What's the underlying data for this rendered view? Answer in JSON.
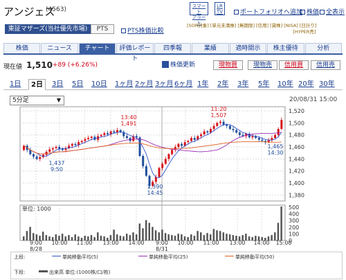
{
  "header": {
    "company": "アンジェス",
    "code": "(4563)",
    "smart_alert": "スマート\nアラート",
    "lr_tv": "LR\nTV",
    "portfolio_link": "ポートフォリオへ追加",
    "stock_price_link": "株価",
    "all_view_link": "全表示"
  },
  "market": {
    "exchange": "東証マザーズ(当社優先市場)",
    "pts": "PTS",
    "pts_compare": "PTS株価比較",
    "badges": [
      "[SOR対象]",
      "[単元未満株]",
      "[無期限]",
      "[信用]",
      "[貸株]",
      "[NISA]",
      "[日計り]",
      "[HYPER売]"
    ]
  },
  "tabs": [
    {
      "label": "株価",
      "active": false
    },
    {
      "label": "ニュース",
      "active": false
    },
    {
      "label": "チャート",
      "active": true
    },
    {
      "label": "評価レポート",
      "active": false
    },
    {
      "label": "四季報",
      "active": false
    },
    {
      "label": "業績",
      "active": false
    },
    {
      "label": "適時開示",
      "active": false
    },
    {
      "label": "株主優待",
      "active": false
    },
    {
      "label": "分析",
      "active": false
    }
  ],
  "price": {
    "label": "現在値",
    "value": "1,510",
    "change": "+89 (+6.26%)",
    "update_label": "株価更新",
    "buttons": [
      "現物買",
      "現物売",
      "信用買",
      "信用売"
    ]
  },
  "periods": [
    "1日",
    "2日",
    "3日",
    "5日",
    "10日",
    "1ヶ月",
    "2ヶ月",
    "3ヶ月",
    "6ヶ月",
    "1年",
    "2年",
    "3年",
    "5年",
    "10年",
    "20年",
    "30年"
  ],
  "active_period": "2日",
  "chart_controls": {
    "interval": "5分足",
    "datetime": "20/08/31 15:00"
  },
  "chart_data": {
    "type": "candlestick",
    "title": "",
    "price_axis": {
      "ticks": [
        "1,520",
        "1,500",
        "1,480",
        "1,460",
        "1,440",
        "1,420",
        "1,400",
        "1,380"
      ],
      "range": [
        1370,
        1527
      ]
    },
    "time_labels": [
      "9:00\n8/28",
      "10:00",
      "11:00",
      "13:00",
      "14:00",
      "15:00",
      "9:00\n8/31",
      "10:00",
      "11:00",
      "13:00",
      "14:00",
      "15:00"
    ],
    "annotations": [
      {
        "time": "9:50",
        "price": "1,437",
        "type": "low"
      },
      {
        "time": "13:40",
        "price": "1,491",
        "type": "high"
      },
      {
        "time": "14:45",
        "price": "1,390",
        "type": "low"
      },
      {
        "time": "11:20",
        "price": "1,507",
        "type": "high"
      },
      {
        "time": "14:30",
        "price": "1,465",
        "type": "low"
      }
    ],
    "volume_axis": {
      "unit_label": "単位: 1000",
      "ticks": [
        "500",
        "400",
        "300",
        "200",
        "100",
        "0"
      ]
    },
    "colors": {
      "up": "#d7141a",
      "down": "#1f4e9c",
      "ma5": "#3355cc",
      "ma25": "#9b2fb5",
      "ma50": "#e06020",
      "volume": "#555555"
    }
  },
  "legend": {
    "upper_label": "上段:",
    "ma5": "単純移動平均(5)",
    "ma25": "単純移動平均(25)",
    "ma50": "単純移動平均(50)",
    "lower_label": "下段:",
    "volume": "出来高 単位:(1000株/口/枚)"
  }
}
